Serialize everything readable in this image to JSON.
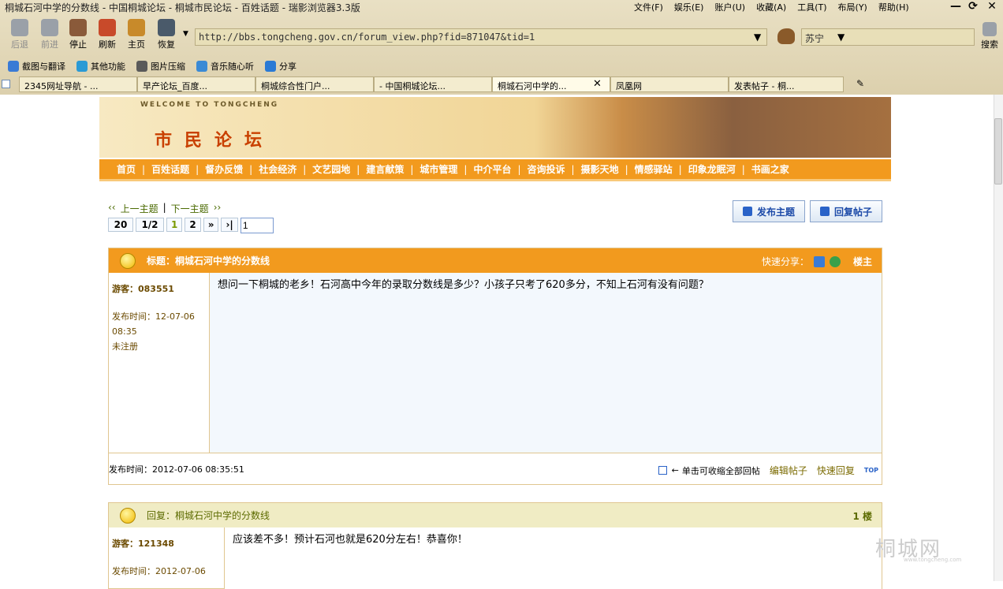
{
  "window": {
    "title": "桐城石河中学的分数线 - 中国桐城论坛 - 桐城市民论坛 - 百姓话题 - 瑞影浏览器3.3版",
    "menus": [
      "文件(F)",
      "娱乐(E)",
      "账户(U)",
      "收藏(A)",
      "工具(T)",
      "布局(Y)",
      "帮助(H)"
    ],
    "controls": [
      "—",
      "⟳",
      "✕"
    ]
  },
  "toolbar": {
    "back": "后退",
    "forward": "前进",
    "stop": "停止",
    "refresh": "刷新",
    "home": "主页",
    "restore": "恢复",
    "url": "http://bbs.tongcheng.gov.cn/forum_view.php?fid=871047&tid=1",
    "dropdown_arrow": "▼",
    "search_engine": "苏宁",
    "search_button": "搜索"
  },
  "links_bar": [
    {
      "label": "截图与翻译",
      "color": "#3a7bd5"
    },
    {
      "label": "其他功能",
      "color": "#2a9ad5"
    },
    {
      "label": "图片压缩",
      "color": "#5a5a5a"
    },
    {
      "label": "音乐随心听",
      "color": "#3a8ad5"
    },
    {
      "label": "分享",
      "color": "#2a7ad5"
    }
  ],
  "tabs": [
    "2345网址导航 - ...",
    "早产论坛_百度...",
    "桐城综合性门户...",
    "- 中国桐城论坛...",
    "桐城石河中学的...",
    "凤凰网",
    "发表帖子 - 桐..."
  ],
  "tab_close": "✕",
  "banner": {
    "welcome": "WELCOME TO TONGCHENG",
    "forum_name": "市民论坛"
  },
  "nav": [
    "首页",
    "百姓话题",
    "督办反馈",
    "社会经济",
    "文艺园地",
    "建言献策",
    "城市管理",
    "中介平台",
    "咨询投诉",
    "摄影天地",
    "情感驿站",
    "印象龙眠河",
    "书画之家"
  ],
  "topic_nav": {
    "prev_arrow": "‹‹",
    "prev": "上一主题",
    "divider": "|",
    "next": "下一主题",
    "next_arrow": "››"
  },
  "pager": {
    "total": "20",
    "page_of": "1/2",
    "current": "1",
    "page2": "2",
    "next": "»",
    "last": "›|",
    "input": "1"
  },
  "buttons": {
    "new_topic": "发布主题",
    "reply": "回复帖子"
  },
  "post1": {
    "title": "标题：桐城石河中学的分数线",
    "share_label": "快速分享：",
    "floor": "楼主",
    "author": "游客：083551",
    "time_label": "发布时间：12-07-06",
    "time_hm": "08:35",
    "status": "未注册",
    "content": "想问一下桐城的老乡！石河高中今年的录取分数线是多少？小孩子只考了620多分，不知上石河有没有问题？",
    "footer_time": "发布时间：2012-07-06 08:35:51",
    "collapse_arrow": "←",
    "collapse_text": "单击可收缩全部回帖",
    "edit": "编辑帖子",
    "quick_reply": "快速回复",
    "top": "TOP"
  },
  "post2": {
    "title": "回复：桐城石河中学的分数线",
    "floor": "1 楼",
    "author": "游客：121348",
    "time_label": "发布时间：2012-07-06",
    "content": "应该差不多！预计石河也就是620分左右！恭喜你！"
  },
  "watermark": "桐城网",
  "watermark_sub": "www.tongcheng.com",
  "colors": {
    "nav_orange": "#f29a1e",
    "link_green": "#4a6a00",
    "button_blue": "#1c4aa8"
  }
}
